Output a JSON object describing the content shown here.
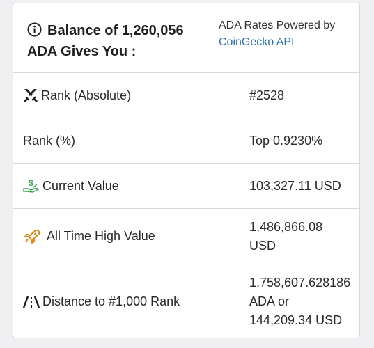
{
  "header": {
    "title_line1": "Balance of 1,260,056",
    "title_line2": "ADA Gives You :",
    "rates_text": "ADA Rates Powered by",
    "rates_link": "CoinGecko API"
  },
  "rows": [
    {
      "label": "Rank (Absolute)",
      "value": "#2528",
      "icon": "crossed-swords-icon"
    },
    {
      "label": "Rank (%)",
      "value": "Top 0.9230%"
    },
    {
      "label": "Current Value",
      "value": "103,327.11 USD",
      "icon": "money-hand-icon"
    },
    {
      "label": "All Time High Value",
      "value_line1": "1,486,866.08",
      "value_line2": "USD",
      "icon": "rocket-icon"
    },
    {
      "label": "Distance to #1,000 Rank",
      "value_line1": "1,758,607.628186",
      "value_line2": "ADA or",
      "value_line3": "144,209.34 USD",
      "icon": "road-icon"
    }
  ],
  "colors": {
    "link": "#2a6fb5",
    "money_icon": "#3aa655",
    "rocket_icon": "#e38a1c"
  }
}
